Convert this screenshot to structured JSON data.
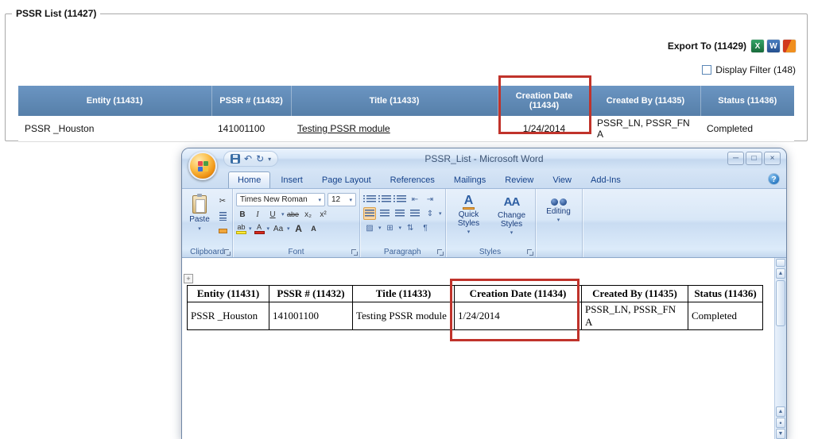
{
  "colors": {
    "table_header_blue": "#5b87b6",
    "annotation_red": "#c0332b",
    "ribbon_blue": "#d8e7f7"
  },
  "pssr_panel": {
    "title": "PSSR List (11427)",
    "export_label": "Export To (11429)",
    "display_filter_label": "Display Filter (148)",
    "table": {
      "headers": [
        "Entity (11431)",
        "PSSR # (11432)",
        "Title (11433)",
        "Creation Date (11434)",
        "Created By (11435)",
        "Status (11436)"
      ],
      "row": [
        "PSSR _Houston",
        "141001100",
        "Testing PSSR module",
        "1/24/2014",
        "PSSR_LN, PSSR_FN A",
        "Completed"
      ]
    }
  },
  "word_window": {
    "title": "PSSR_List - Microsoft Word",
    "tabs": [
      "Home",
      "Insert",
      "Page Layout",
      "References",
      "Mailings",
      "Review",
      "View",
      "Add-Ins"
    ],
    "ribbon": {
      "paste_label": "Paste",
      "clipboard_label": "Clipboard",
      "font_label": "Font",
      "font_name": "Times New Roman",
      "font_size": "12",
      "paragraph_label": "Paragraph",
      "styles_label": "Styles",
      "quick_styles_label": "Quick Styles",
      "change_styles_label": "Change Styles",
      "editing_label": "Editing"
    },
    "document_table": {
      "headers": [
        "Entity (11431)",
        "PSSR # (11432)",
        "Title (11433)",
        "Creation Date (11434)",
        "Created By (11435)",
        "Status (11436)"
      ],
      "row": [
        "PSSR _Houston",
        "141001100",
        "Testing PSSR module",
        "1/24/2014",
        "PSSR_LN, PSSR_FN A",
        "Completed"
      ]
    }
  },
  "icons": {
    "excel": "X",
    "word": "W",
    "minimize": "─",
    "restore": "□",
    "close": "×",
    "undo": "↶",
    "redo": "↻",
    "dropdown": "▾",
    "help": "?",
    "cut": "✂",
    "bold": "B",
    "italic": "I",
    "underline": "U",
    "strike": "abe",
    "subscript": "x₂",
    "superscript": "x²",
    "highlight": "ab",
    "font_color": "A",
    "change_case": "Aa",
    "grow_font": "A",
    "shrink_font": "A",
    "outdent": "⇤",
    "indent": "⇥",
    "line_spacing": "⇕",
    "shading": "▨",
    "borders": "⊞",
    "sort": "⇅",
    "pilcrow": "¶",
    "quick_styles": "A",
    "change_styles": "AA",
    "scroll_up": "▲",
    "prev_page": "▲",
    "browse_dot": "•",
    "next_page": "▼",
    "table_handle": "+"
  }
}
